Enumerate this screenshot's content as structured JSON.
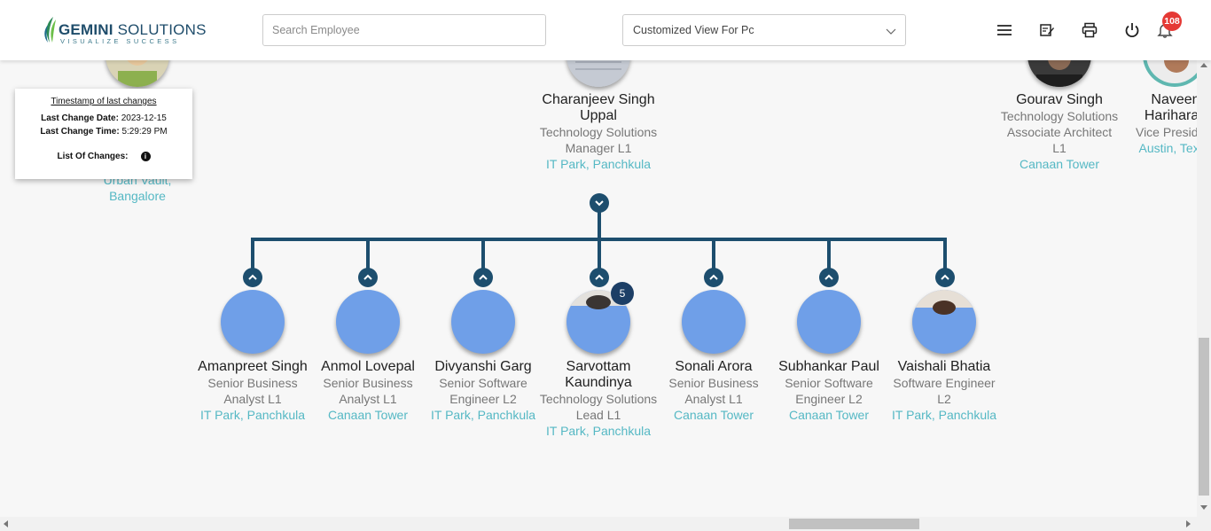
{
  "header": {
    "logo_name_bold": "GEMINI",
    "logo_name": " SOLUTIONS",
    "logo_tagline": "VISUALIZE SUCCESS",
    "search_placeholder": "Search Employee",
    "view_select_value": "Customized View For Pc",
    "notification_count": "108",
    "icons": [
      "menu-icon",
      "edit-note-icon",
      "print-icon",
      "power-icon",
      "bell-icon"
    ]
  },
  "timestamp_popup": {
    "title": "Timestamp of last changes",
    "date_label": "Last Change Date:",
    "date_value": "2023-12-15",
    "time_label": "Last Change Time:",
    "time_value": "5:29:29 PM",
    "changes_label": "List Of Changes:"
  },
  "top_row": [
    {
      "name": "",
      "title": "",
      "location": "Urban Vault, Bangalore"
    },
    {
      "name": "Charanjeev Singh Uppal",
      "title": "Technology Solutions Manager L1",
      "location": "IT Park, Panchkula"
    },
    {
      "name": "Gourav Singh",
      "title": "Technology Solutions Associate Architect L1",
      "location": "Canaan Tower"
    },
    {
      "name": "Naveen Hariharan",
      "title": "Vice President",
      "location": "Austin, Texas"
    }
  ],
  "reports": [
    {
      "name": "Amanpreet Singh",
      "title": "Senior Business Analyst L1",
      "location": "IT Park, Panchkula"
    },
    {
      "name": "Anmol Lovepal",
      "title": "Senior Business Analyst L1",
      "location": "Canaan Tower"
    },
    {
      "name": "Divyanshi Garg",
      "title": "Senior Software Engineer L2",
      "location": "IT Park, Panchkula"
    },
    {
      "name": "Sarvottam Kaundinya",
      "title": "Technology Solutions Lead L1",
      "location": "IT Park, Panchkula",
      "reports_count": "5"
    },
    {
      "name": "Sonali Arora",
      "title": "Senior Business Analyst L1",
      "location": "Canaan Tower"
    },
    {
      "name": "Subhankar Paul",
      "title": "Senior Software Engineer L2",
      "location": "Canaan Tower"
    },
    {
      "name": "Vaishali Bhatia",
      "title": "Software Engineer L2",
      "location": "IT Park, Panchkula"
    }
  ],
  "colors": {
    "accent": "#1d4e6e",
    "location": "#55b8c4",
    "avatar_placeholder": "#6f9fe8",
    "badge": "#e53935"
  }
}
